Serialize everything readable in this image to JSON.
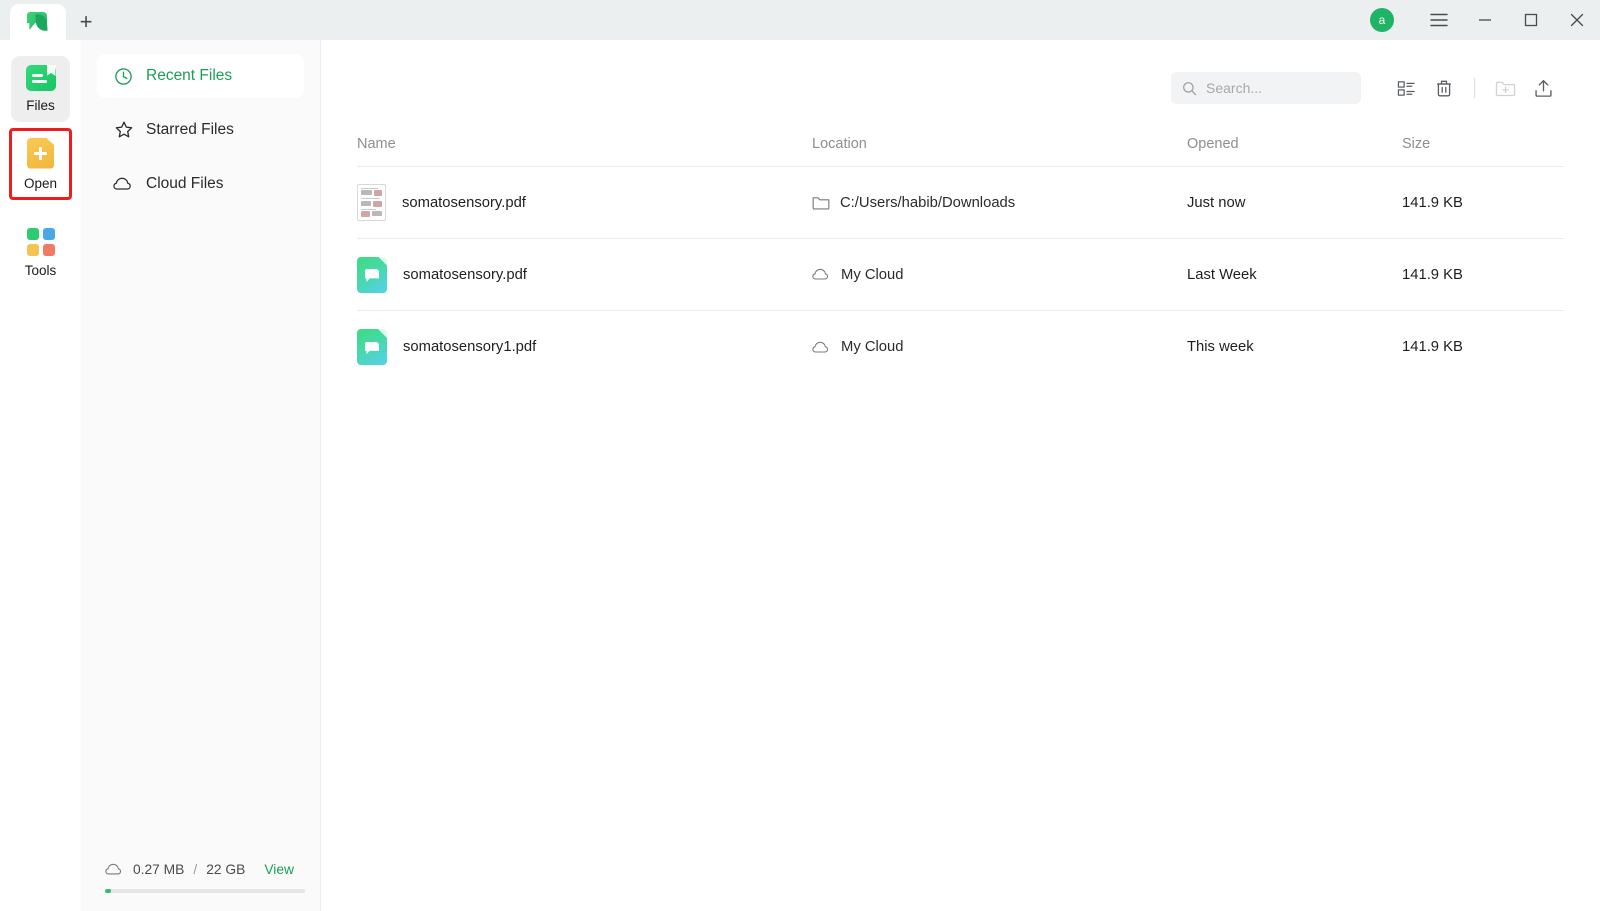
{
  "window": {
    "tab_tooltip": "UPDF",
    "new_tab_label": "+",
    "avatar_letter": "a",
    "menu_label": "Menu",
    "minimize_label": "Minimize",
    "maximize_label": "Maximize",
    "close_label": "Close"
  },
  "rail": {
    "items": [
      {
        "label": "Files",
        "icon": "files-icon",
        "active": true,
        "highlighted": false
      },
      {
        "label": "Open",
        "icon": "open-file-icon",
        "active": false,
        "highlighted": true
      },
      {
        "label": "Tools",
        "icon": "tools-grid-icon",
        "active": false,
        "highlighted": false
      }
    ],
    "highlight_color": "#f01b1b"
  },
  "sidebar": {
    "items": [
      {
        "label": "Recent Files",
        "icon": "clock-icon",
        "active": true
      },
      {
        "label": "Starred Files",
        "icon": "star-icon",
        "active": false
      },
      {
        "label": "Cloud Files",
        "icon": "cloud-icon",
        "active": false
      }
    ],
    "storage": {
      "icon": "cloud-icon",
      "used": "0.27 MB",
      "separator": "/",
      "total": "22 GB",
      "view_label": "View",
      "percent": 3
    },
    "accent_color": "#1b9e57"
  },
  "toolbar": {
    "search": {
      "placeholder": "Search...",
      "value": "",
      "icon": "search-icon"
    },
    "buttons": [
      {
        "name": "list-view-icon",
        "label": "List view"
      },
      {
        "name": "trash-icon",
        "label": "Recycle bin"
      },
      {
        "name": "new-folder-icon",
        "label": "New folder"
      },
      {
        "name": "upload-icon",
        "label": "Upload"
      }
    ]
  },
  "table": {
    "headers": {
      "name": "Name",
      "location": "Location",
      "opened": "Opened",
      "size": "Size"
    },
    "rows": [
      {
        "icon": "document-thumbnail",
        "name": "somatosensory.pdf",
        "location_icon": "folder-icon",
        "location": "C:/Users/habib/Downloads",
        "opened": "Just now",
        "size": "141.9 KB"
      },
      {
        "icon": "pdf-cloud-icon",
        "name": "somatosensory.pdf",
        "location_icon": "cloud-icon",
        "location": "My Cloud",
        "opened": "Last Week",
        "size": "141.9 KB"
      },
      {
        "icon": "pdf-cloud-icon",
        "name": "somatosensory1.pdf",
        "location_icon": "cloud-icon",
        "location": "My Cloud",
        "opened": "This week",
        "size": "141.9 KB"
      }
    ]
  }
}
